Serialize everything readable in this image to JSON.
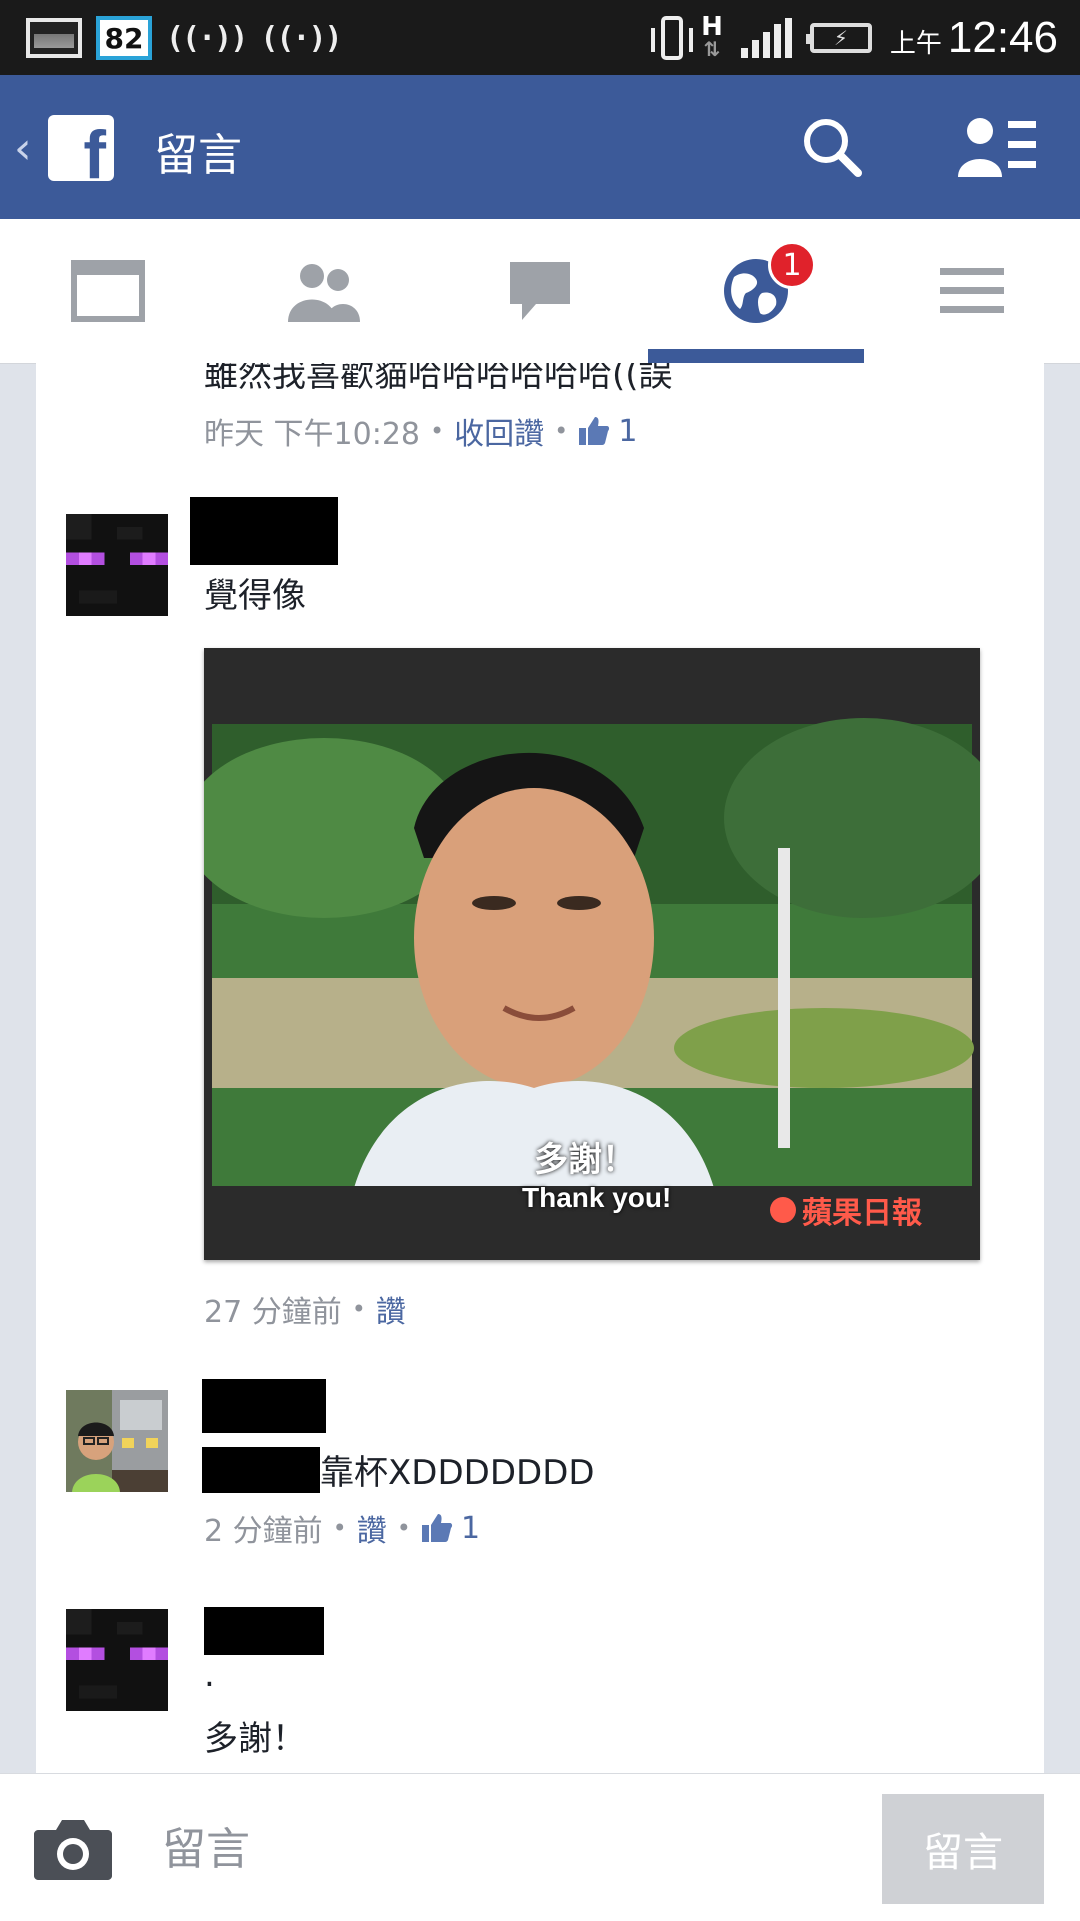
{
  "status_bar": {
    "notification_number": "82",
    "network_type": "H",
    "ampm": "上午",
    "time": "12:46"
  },
  "header": {
    "title": "留言"
  },
  "tabs": {
    "globe_badge": "1"
  },
  "comments": [
    {
      "text": "雖然我喜歡貓哈哈哈哈哈哈((誤",
      "time": "昨天 下午10:28",
      "action": "收回讚",
      "like_count": "1"
    },
    {
      "text": "覺得像",
      "image_caption_zh": "多謝！",
      "image_caption_en": "Thank you!",
      "image_watermark": "蘋果日報",
      "time": "27 分鐘前",
      "action": "讚"
    },
    {
      "text": "靠杯XDDDDDDD",
      "time": "2 分鐘前",
      "action": "讚",
      "like_count": "1"
    },
    {
      "line1": ".",
      "text": "多謝！"
    }
  ],
  "composer": {
    "placeholder": "留言",
    "post_label": "留言"
  },
  "colors": {
    "brand": "#3c5a99",
    "badge": "#e0222b",
    "link": "#4b67a1"
  }
}
